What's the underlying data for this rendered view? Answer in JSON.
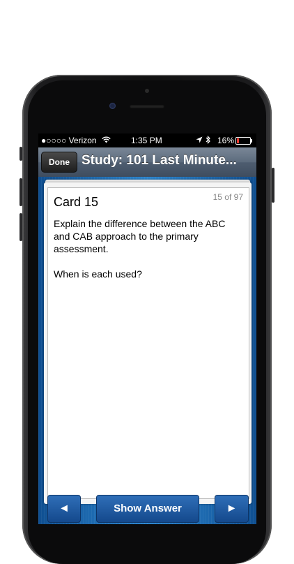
{
  "status_bar": {
    "carrier": "●○○○○ Verizon",
    "wifi_icon": "wifi-icon",
    "time": "1:35 PM",
    "location_icon": "location-arrow-icon",
    "bluetooth_icon": "bluetooth-icon",
    "battery_percent": "16%",
    "battery_level": 0.16,
    "battery_color": "#ff3b30"
  },
  "nav": {
    "done_label": "Done",
    "title": "Study: 101 Last Minute..."
  },
  "card": {
    "title": "Card 15",
    "counter": "15 of 97",
    "paragraphs": [
      "Explain the difference between the ABC and CAB approach to the primary assessment.",
      "When is each used?"
    ]
  },
  "toolbar": {
    "prev_arrow": "◄",
    "show_answer_label": "Show Answer",
    "next_arrow": "►"
  },
  "colors": {
    "accent_blue": "#2c86d0",
    "button_blue": "#14498c"
  }
}
